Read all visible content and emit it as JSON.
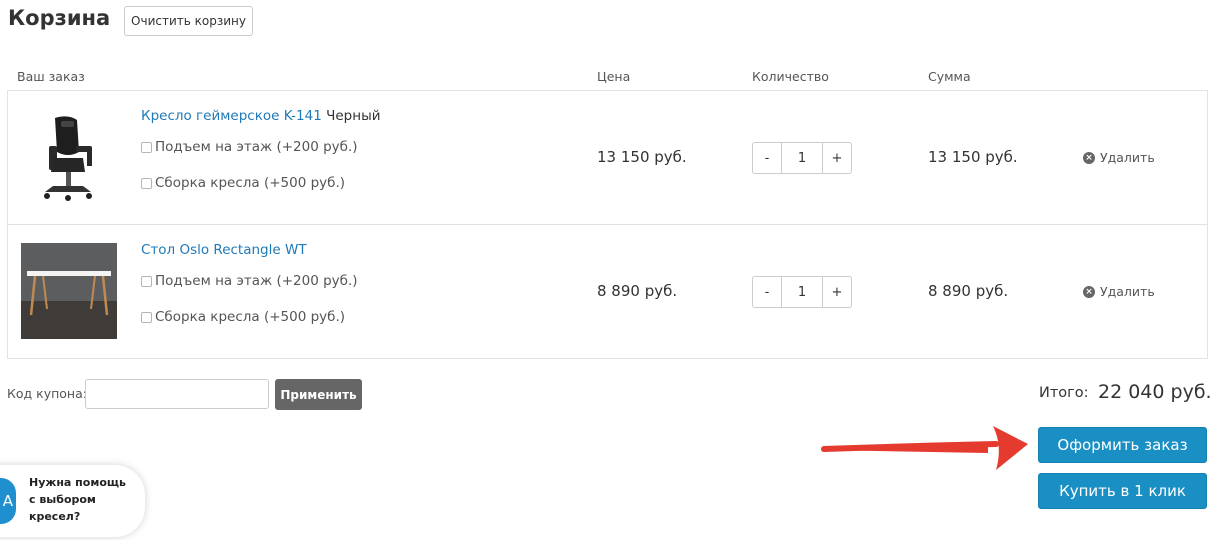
{
  "header": {
    "title": "Корзина",
    "clear_cart_label": "Очистить корзину"
  },
  "columns": {
    "order": "Ваш заказ",
    "price": "Цена",
    "quantity": "Количество",
    "sum": "Сумма"
  },
  "items": [
    {
      "name": "Кресло геймерское K-141",
      "suffix": "Черный",
      "options": [
        "Подъем на этаж (+200 руб.)",
        "Сборка кресла (+500 руб.)"
      ],
      "price": "13 150 руб.",
      "qty": "1",
      "sum": "13 150 руб.",
      "delete_label": "Удалить"
    },
    {
      "name": "Стол Oslo Rectangle WT",
      "suffix": "",
      "options": [
        "Подъем на этаж (+200 руб.)",
        "Сборка кресла (+500 руб.)"
      ],
      "price": "8 890 руб.",
      "qty": "1",
      "sum": "8 890 руб.",
      "delete_label": "Удалить"
    }
  ],
  "qty_controls": {
    "minus": "-",
    "plus": "+"
  },
  "coupon": {
    "label": "Код купона:",
    "value": "",
    "apply_label": "Применить"
  },
  "total": {
    "label": "Итого:",
    "value": "22 040 руб."
  },
  "actions": {
    "checkout_label": "Оформить заказ",
    "one_click_label": "Купить в 1 клик"
  },
  "help_widget": {
    "text": "Нужна помощь с выбором кресел?",
    "avatar_letter": "A"
  },
  "colors": {
    "link": "#1f7ab8",
    "primary": "#1a8fc4",
    "arrow": "#e53a2e",
    "apply_bg": "#666666"
  },
  "icons": {
    "delete": "circle-x-icon",
    "annotation": "red-arrow"
  }
}
